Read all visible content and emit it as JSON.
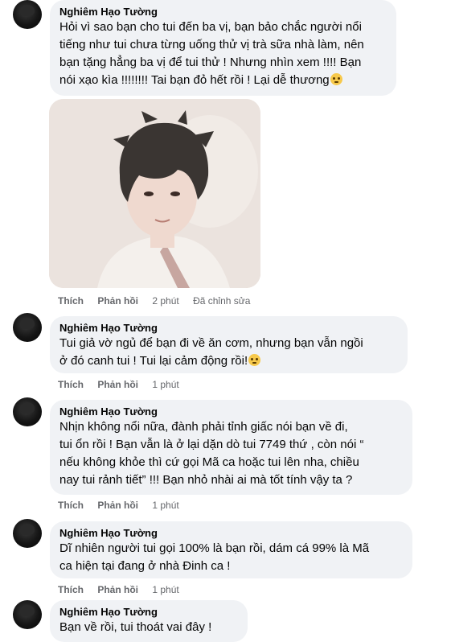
{
  "comments": [
    {
      "author": "Nghiêm Hạo Tường",
      "text": "Hỏi vì sao bạn cho tui đến ba vị, bạn bảo chắc người nổi\ntiếng như tui chưa từng uống thử vị trà sữa nhà làm, nên\nbạn tặng hẳng ba vị để tui thử ! Nhưng nhìn xem !!!! Bạn\nnói xạo kìa !!!!!!!! Tai bạn đỏ hết rồi ! Lại dễ thương",
      "has_emoji": true,
      "like_label": "Thích",
      "reply_label": "Phản hồi",
      "time": "2 phút",
      "edited": "Đã chỉnh sửa"
    },
    {
      "author": "Nghiêm Hạo Tường",
      "text": "Tui giả vờ ngủ để bạn đi về ăn cơm, nhưng bạn vẫn ngồi\nở đó canh tui ! Tui lại cảm động rồi!",
      "has_emoji": true,
      "like_label": "Thích",
      "reply_label": "Phản hồi",
      "time": "1 phút"
    },
    {
      "author": "Nghiêm Hạo Tường",
      "text": "Nhịn không nổi nữa, đành phải tỉnh giấc nói bạn về đi,\ntui ổn rồi ! Bạn vẫn là ở lại dặn dò tui 7749 thứ , còn nói “\nnếu không khỏe thì cứ gọi Mã ca hoặc tui lên nha, chiều\nnay tui rảnh tiết” !!! Bạn nhỏ nhài ai mà tốt tính vậy ta ?",
      "like_label": "Thích",
      "reply_label": "Phản hồi",
      "time": "1 phút"
    },
    {
      "author": "Nghiêm Hạo Tường",
      "text": "Dĩ nhiên người tui gọi 100% là bạn rồi, dám cá 99% là Mã\nca hiện tại đang ở nhà Đinh ca !",
      "like_label": "Thích",
      "reply_label": "Phản hồi",
      "time": "1 phút"
    },
    {
      "author": "Nghiêm Hạo Tường",
      "text": "Bạn về rồi, tui thoát vai đây !"
    }
  ],
  "colors": {
    "bubble": "#f0f2f5",
    "text": "#050505",
    "meta": "#65676b",
    "emoji": "#f7c94b"
  }
}
